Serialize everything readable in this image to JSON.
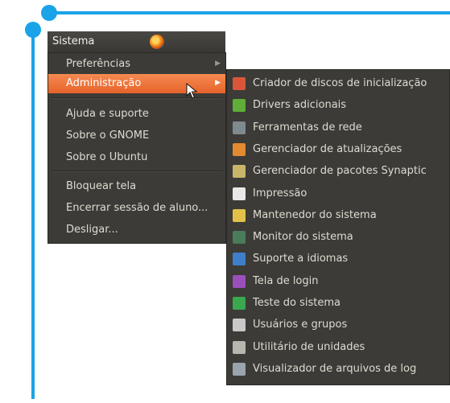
{
  "panel": {
    "menu_label": "Sistema"
  },
  "main_menu": {
    "items": [
      {
        "label": "Preferências",
        "has_submenu": true
      },
      {
        "label": "Administração",
        "has_submenu": true,
        "active": true
      },
      {
        "label": "Ajuda e suporte"
      },
      {
        "label": "Sobre o GNOME"
      },
      {
        "label": "Sobre o Ubuntu"
      },
      {
        "label": "Bloquear tela"
      },
      {
        "label": "Encerrar sessão de aluno..."
      },
      {
        "label": "Desligar..."
      }
    ]
  },
  "submenu": {
    "items": [
      {
        "label": "Criador de discos de inicialização",
        "icon": "startup-disk-icon",
        "color": "#d9563a"
      },
      {
        "label": "Drivers adicionais",
        "icon": "drivers-icon",
        "color": "#5fae3a"
      },
      {
        "label": "Ferramentas de rede",
        "icon": "network-tools-icon",
        "color": "#7f8a8f"
      },
      {
        "label": "Gerenciador de atualizações",
        "icon": "update-manager-icon",
        "color": "#e18a2f"
      },
      {
        "label": "Gerenciador de pacotes Synaptic",
        "icon": "synaptic-icon",
        "color": "#c8b56a"
      },
      {
        "label": "Impressão",
        "icon": "printer-icon",
        "color": "#e8e8e8"
      },
      {
        "label": "Mantenedor do sistema",
        "icon": "broom-icon",
        "color": "#e2c14a"
      },
      {
        "label": "Monitor do sistema",
        "icon": "system-monitor-icon",
        "color": "#4a7c59"
      },
      {
        "label": "Suporte a idiomas",
        "icon": "language-icon",
        "color": "#3f7fc9"
      },
      {
        "label": "Tela de login",
        "icon": "login-screen-icon",
        "color": "#9b4fb8"
      },
      {
        "label": "Teste do sistema",
        "icon": "checkbox-icon",
        "color": "#3aa84f"
      },
      {
        "label": "Usuários e grupos",
        "icon": "users-icon",
        "color": "#c9c9c9"
      },
      {
        "label": "Utilitário de unidades",
        "icon": "disk-utility-icon",
        "color": "#b7b7b0"
      },
      {
        "label": "Visualizador de arquivos de log",
        "icon": "log-viewer-icon",
        "color": "#9aa4ad"
      }
    ]
  },
  "accent_color": "#1aa3e8",
  "highlight_color": "#f07c3e"
}
